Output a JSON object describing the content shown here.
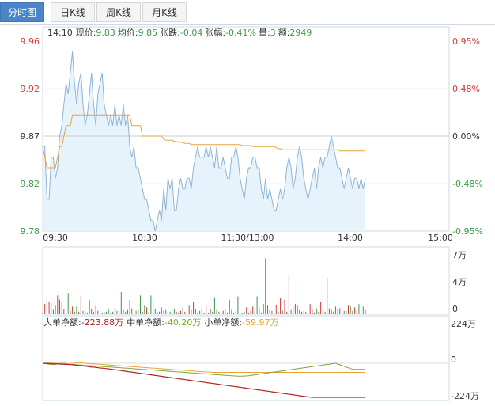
{
  "tabs": [
    {
      "label": "分时图",
      "active": true
    },
    {
      "label": "日K线",
      "active": false
    },
    {
      "label": "周K线",
      "active": false
    },
    {
      "label": "月K线",
      "active": false
    }
  ],
  "quote": {
    "time": "14:10",
    "price_label": "现价:",
    "price": "9.83",
    "avg_label": "均价:",
    "avg": "9.85",
    "change_label": "张跌:",
    "change": "-0.04",
    "pct_label": "张幅:",
    "pct": "-0.41%",
    "vol_label": "量:",
    "vol": "3",
    "amt_label": "额:",
    "amt": "2949"
  },
  "flow": {
    "large_label": "大单净额:",
    "large": "-223.88万",
    "mid_label": "中单净额:",
    "mid": "-40.20万",
    "small_label": "小单净额:",
    "small": "-59.97万"
  },
  "colors": {
    "price": "#8fb4d6",
    "avg": "#e8a33a",
    "up": "#d33a3a",
    "down": "#3a9a4a",
    "large": "#b22222",
    "mid": "#7aa82e",
    "small": "#e8a33a",
    "ref": "#888888"
  },
  "chart_data": [
    {
      "type": "line",
      "name": "price",
      "yticks_left": [
        "9.96",
        "9.92",
        "9.87",
        "9.82",
        "9.78"
      ],
      "yticks_right": [
        "0.95%",
        "0.48%",
        "0.00%",
        "-0.48%",
        "-0.95%"
      ],
      "xticks": [
        "09:30",
        "10:30",
        "11:30/13:00",
        "14:00",
        "15:00"
      ],
      "ylim": [
        9.78,
        9.96
      ],
      "prev_close": 9.87,
      "price": [
        9.86,
        9.86,
        9.81,
        9.81,
        9.85,
        9.85,
        9.83,
        9.84,
        9.87,
        9.88,
        9.9,
        9.92,
        9.91,
        9.93,
        9.95,
        9.92,
        9.9,
        9.92,
        9.93,
        9.9,
        9.88,
        9.89,
        9.91,
        9.93,
        9.9,
        9.88,
        9.91,
        9.92,
        9.93,
        9.9,
        9.89,
        9.88,
        9.89,
        9.88,
        9.9,
        9.88,
        9.89,
        9.88,
        9.9,
        9.88,
        9.89,
        9.86,
        9.85,
        9.86,
        9.84,
        9.84,
        9.83,
        9.82,
        9.81,
        9.81,
        9.8,
        9.79,
        9.79,
        9.78,
        9.79,
        9.8,
        9.79,
        9.82,
        9.8,
        9.83,
        9.82,
        9.83,
        9.8,
        9.8,
        9.82,
        9.83,
        9.82,
        9.82,
        9.83,
        9.83,
        9.82,
        9.84,
        9.85,
        9.86,
        9.85,
        9.85,
        9.85,
        9.86,
        9.85,
        9.86,
        9.85,
        9.84,
        9.86,
        9.84,
        9.84,
        9.85,
        9.84,
        9.83,
        9.83,
        9.85,
        9.85,
        9.86,
        9.85,
        9.83,
        9.82,
        9.81,
        9.83,
        9.84,
        9.84,
        9.85,
        9.85,
        9.84,
        9.84,
        9.82,
        9.81,
        9.83,
        9.81,
        9.82,
        9.81,
        9.8,
        9.8,
        9.81,
        9.82,
        9.81,
        9.82,
        9.84,
        9.85,
        9.84,
        9.82,
        9.83,
        9.85,
        9.86,
        9.85,
        9.83,
        9.82,
        9.81,
        9.82,
        9.83,
        9.84,
        9.82,
        9.84,
        9.85,
        9.84,
        9.85,
        9.85,
        9.86,
        9.87,
        9.86,
        9.85,
        9.84,
        9.84,
        9.83,
        9.82,
        9.83,
        9.84,
        9.83,
        9.82,
        9.83,
        9.83,
        9.82,
        9.83,
        9.82,
        9.83
      ],
      "avg": [
        9.86,
        9.85,
        9.84,
        9.84,
        9.84,
        9.84,
        9.84,
        9.85,
        9.86,
        9.86,
        9.87,
        9.88,
        9.88,
        9.88,
        9.89,
        9.89,
        9.89,
        9.89,
        9.89,
        9.89,
        9.89,
        9.89,
        9.89,
        9.89,
        9.89,
        9.89,
        9.89,
        9.89,
        9.89,
        9.89,
        9.89,
        9.89,
        9.89,
        9.89,
        9.89,
        9.89,
        9.89,
        9.89,
        9.89,
        9.89,
        9.89,
        9.89,
        9.88,
        9.88,
        9.88,
        9.88,
        9.88,
        9.87,
        9.87,
        9.87,
        9.87,
        9.87,
        9.87,
        9.87,
        9.87,
        9.87,
        9.87,
        9.867,
        9.866,
        9.866,
        9.866,
        9.866,
        9.865,
        9.865,
        9.864,
        9.864,
        9.864,
        9.863,
        9.863,
        9.863,
        9.862,
        9.862,
        9.862,
        9.862,
        9.862,
        9.862,
        9.862,
        9.862,
        9.862,
        9.862,
        9.862,
        9.862,
        9.862,
        9.862,
        9.862,
        9.862,
        9.862,
        9.862,
        9.862,
        9.862,
        9.862,
        9.862,
        9.862,
        9.862,
        9.861,
        9.861,
        9.861,
        9.861,
        9.861,
        9.86,
        9.86,
        9.86,
        9.86,
        9.86,
        9.86,
        9.86,
        9.86,
        9.86,
        9.86,
        9.86,
        9.859,
        9.858,
        9.858,
        9.857,
        9.857,
        9.857,
        9.857,
        9.857,
        9.857,
        9.857,
        9.857,
        9.857,
        9.857,
        9.857,
        9.857,
        9.857,
        9.857,
        9.857,
        9.857,
        9.857,
        9.857,
        9.857,
        9.857,
        9.857,
        9.857,
        9.857,
        9.857,
        9.857,
        9.857,
        9.857,
        9.856,
        9.856,
        9.856,
        9.856,
        9.856,
        9.856,
        9.856,
        9.856,
        9.856,
        9.856,
        9.856,
        9.856,
        9.856
      ]
    },
    {
      "type": "bar",
      "name": "volume",
      "yticks_right": [
        "7万",
        "4万",
        "0"
      ],
      "ylim": [
        0,
        70000
      ],
      "values": [
        2000,
        12000,
        18000,
        15000,
        13000,
        5000,
        11000,
        22000,
        17000,
        14000,
        6000,
        3000,
        25000,
        4000,
        9000,
        3000,
        9000,
        3000,
        21000,
        4000,
        5000,
        2000,
        17000,
        6000,
        3000,
        10000,
        4000,
        7000,
        2000,
        3000,
        3000,
        6000,
        2000,
        3000,
        7000,
        4000,
        4000,
        26000,
        5000,
        3000,
        5000,
        17000,
        7000,
        2000,
        4000,
        5000,
        22000,
        3000,
        10000,
        8000,
        3000,
        22000,
        19000,
        6000,
        3000,
        3000,
        8000,
        4000,
        5000,
        3000,
        3000,
        2000,
        6000,
        3000,
        2000,
        4000,
        8000,
        3000,
        2000,
        10000,
        5000,
        14000,
        6000,
        2000,
        4000,
        8000,
        2000,
        11000,
        2000,
        6000,
        3000,
        20000,
        5000,
        3000,
        7000,
        4000,
        6000,
        2000,
        17000,
        5000,
        2000,
        4000,
        21000,
        4000,
        2000,
        3000,
        8000,
        2000,
        4000,
        9000,
        4000,
        21000,
        8000,
        2000,
        12000,
        66000,
        10000,
        5000,
        4000,
        2000,
        11000,
        3000,
        19000,
        4000,
        17000,
        3000,
        46000,
        5000,
        9000,
        12000,
        10000,
        5000,
        3000,
        4000,
        3000,
        7000,
        12000,
        5000,
        2000,
        7000,
        3000,
        15000,
        6000,
        3000,
        43000,
        7000,
        5000,
        3000,
        9000,
        6000,
        7000,
        8000,
        4000,
        4000,
        10000,
        9000,
        4000,
        8000,
        5000,
        12000,
        4000,
        9000,
        5000
      ]
    },
    {
      "type": "line",
      "name": "net-flow",
      "yticks_right": [
        "224万",
        "0",
        "-224万"
      ],
      "ylim": [
        -224,
        224
      ],
      "large": [
        0,
        -1,
        -2,
        -3,
        -3,
        -4,
        -3,
        -4,
        -5,
        -6,
        -7,
        -8,
        -8,
        -9,
        -10,
        -12,
        -14,
        -15,
        -16,
        -18,
        -20,
        -22,
        -24,
        -25,
        -26,
        -28,
        -30,
        -32,
        -33,
        -35,
        -36,
        -38,
        -40,
        -42,
        -44,
        -46,
        -48,
        -50,
        -52,
        -54,
        -56,
        -58,
        -60,
        -62,
        -64,
        -66,
        -68,
        -70,
        -72,
        -74,
        -76,
        -78,
        -80,
        -82,
        -84,
        -86,
        -88,
        -90,
        -92,
        -94,
        -96,
        -98,
        -100,
        -102,
        -104,
        -106,
        -108,
        -110,
        -112,
        -114,
        -116,
        -118,
        -120,
        -122,
        -124,
        -126,
        -128,
        -130,
        -132,
        -134,
        -136,
        -138,
        -140,
        -142,
        -144,
        -146,
        -148,
        -150,
        -152,
        -154,
        -156,
        -158,
        -160,
        -162,
        -164,
        -166,
        -168,
        -170,
        -172,
        -174,
        -176,
        -178,
        -180,
        -182,
        -184,
        -186,
        -188,
        -190,
        -192,
        -194,
        -196,
        -198,
        -200,
        -202,
        -204,
        -206,
        -208,
        -210,
        -212,
        -214,
        -216,
        -218,
        -220,
        -222,
        -223,
        -223.88,
        -223.88,
        -223.88,
        -223.88,
        -223.88,
        -223.88,
        -223.88,
        -223.88,
        -223.88,
        -223.88,
        -223.88,
        -223.88,
        -223.88,
        -223.88,
        -223.88,
        -223.88,
        -223.88,
        -223.88,
        -223.88,
        -223.88,
        -223.88,
        -223.88,
        -223.88,
        -223.88,
        -223.88
      ],
      "mid": [
        0,
        -2,
        -4,
        -5,
        -6,
        -8,
        -6,
        -4,
        -2,
        0,
        -1,
        -3,
        -5,
        -7,
        -6,
        -8,
        -10,
        -11,
        -12,
        -13,
        -14,
        -15,
        -16,
        -16,
        -17,
        -18,
        -19,
        -20,
        -21,
        -22,
        -23,
        -24,
        -25,
        -26,
        -27,
        -28,
        -29,
        -30,
        -31,
        -32,
        -33,
        -34,
        -35,
        -36,
        -37,
        -38,
        -39,
        -40,
        -41,
        -42,
        -43,
        -44,
        -45,
        -46,
        -47,
        -48,
        -49,
        -50,
        -51,
        -52,
        -53,
        -54,
        -55,
        -56,
        -57,
        -58,
        -59,
        -60,
        -61,
        -62,
        -63,
        -64,
        -65,
        -66,
        -67,
        -68,
        -69,
        -70,
        -71,
        -72,
        -73,
        -74,
        -75,
        -76,
        -77,
        -78,
        -79,
        -80,
        -81,
        -82,
        -83,
        -84,
        -85,
        -85,
        -85,
        -84,
        -83,
        -82,
        -80,
        -78,
        -76,
        -74,
        -72,
        -70,
        -68,
        -66,
        -64,
        -62,
        -60,
        -58,
        -56,
        -54,
        -52,
        -50,
        -48,
        -46,
        -44,
        -42,
        -40,
        -38,
        -36,
        -34,
        -32,
        -30,
        -28,
        -26,
        -24,
        -22,
        -20,
        -18,
        -16,
        -14,
        -12,
        -10,
        -8,
        -6,
        -4,
        -2,
        0,
        -5,
        -10,
        -15,
        -20,
        -25,
        -30,
        -35,
        -40,
        -40.2,
        -40.2,
        -40.2,
        -40.2,
        -40.2,
        -40.2
      ],
      "small": [
        0,
        1,
        2,
        3,
        4,
        5,
        6,
        7,
        8,
        9,
        10,
        9,
        8,
        7,
        6,
        5,
        4,
        3,
        2,
        1,
        0,
        -1,
        -2,
        -3,
        -4,
        -5,
        -6,
        -7,
        -8,
        -9,
        -10,
        -11,
        -12,
        -13,
        -14,
        -15,
        -16,
        -17,
        -18,
        -19,
        -20,
        -21,
        -22,
        -23,
        -24,
        -25,
        -26,
        -27,
        -28,
        -29,
        -30,
        -31,
        -32,
        -33,
        -34,
        -35,
        -36,
        -37,
        -38,
        -39,
        -40,
        -41,
        -42,
        -43,
        -44,
        -45,
        -46,
        -47,
        -48,
        -49,
        -50,
        -51,
        -52,
        -53,
        -54,
        -55,
        -56,
        -57,
        -58,
        -59,
        -60,
        -60,
        -60,
        -60,
        -60,
        -60,
        -60,
        -60,
        -60,
        -60,
        -60,
        -60,
        -60,
        -60,
        -60,
        -60,
        -60,
        -60,
        -60,
        -60,
        -60,
        -60,
        -60,
        -60,
        -60,
        -60,
        -60,
        -60,
        -60,
        -60,
        -60,
        -60,
        -60,
        -60,
        -60,
        -60,
        -60,
        -60,
        -60,
        -60,
        -60,
        -60,
        -60,
        -60,
        -60,
        -60,
        -60,
        -60,
        -60,
        -60,
        -60,
        -60,
        -60,
        -60,
        -60,
        -60,
        -60,
        -60,
        -60,
        -60,
        -60,
        -60,
        -60,
        -60,
        -60,
        -60,
        -60,
        -60,
        -60,
        -60,
        -59.97,
        -59.97,
        -59.97
      ]
    }
  ]
}
